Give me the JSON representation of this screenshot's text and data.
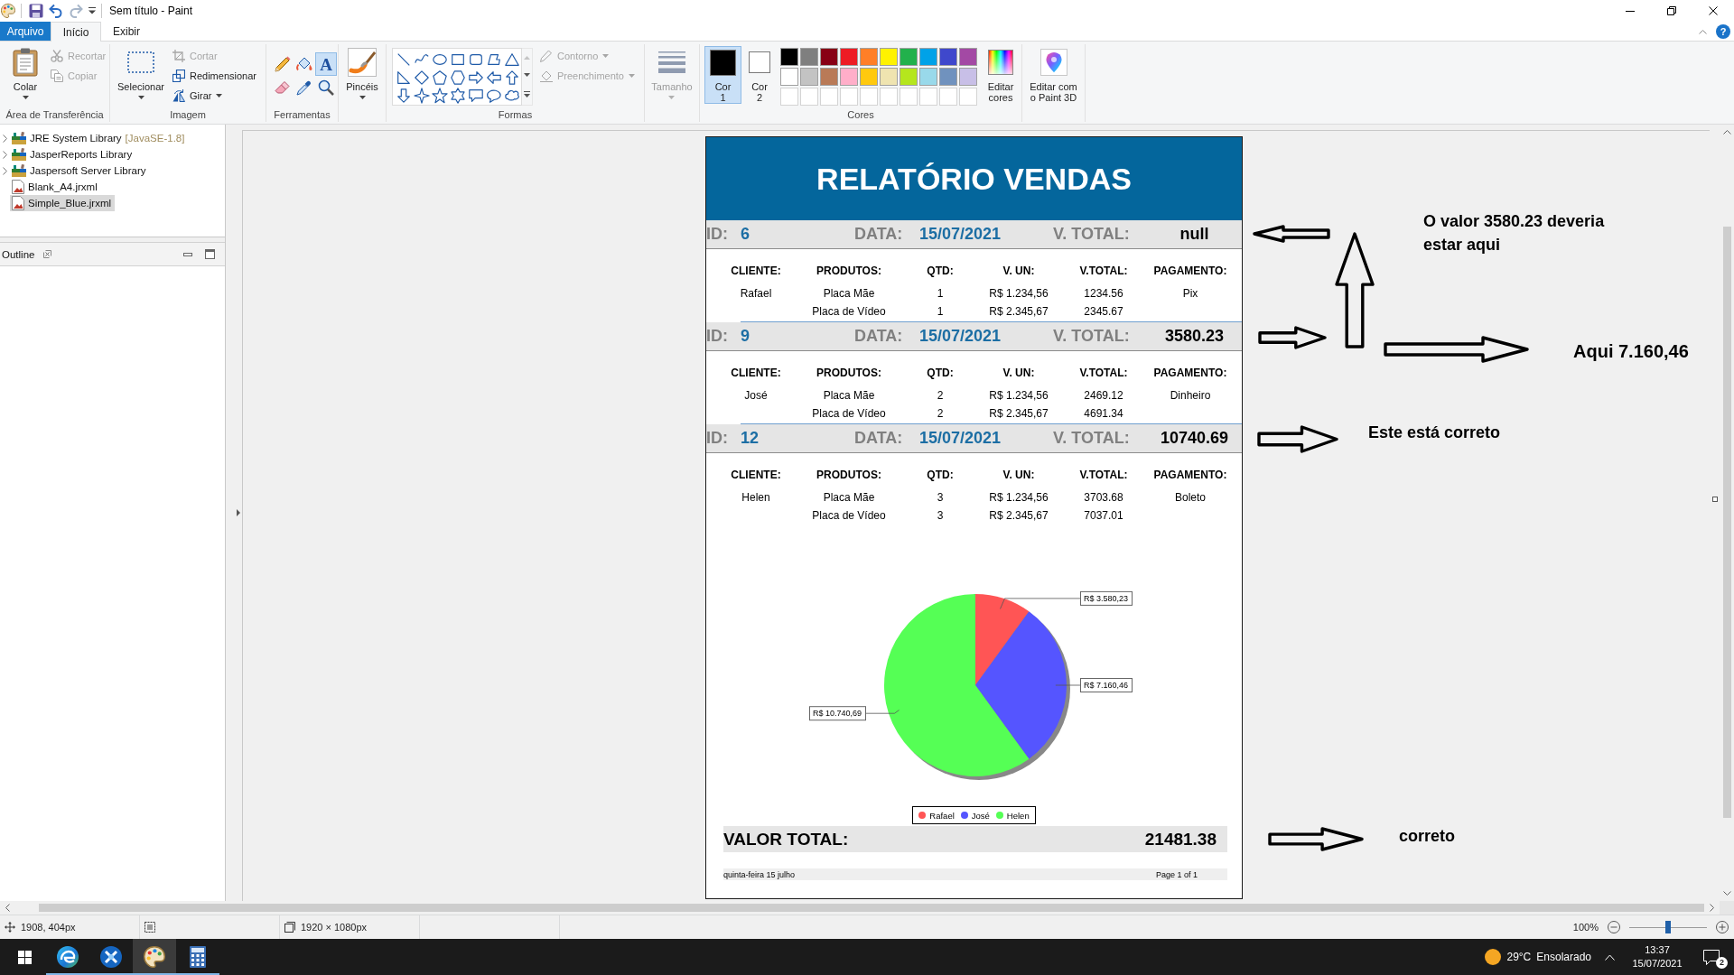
{
  "window": {
    "title": "Sem título - Paint",
    "quick_access": [
      {
        "kind": "save",
        "disabled": false
      },
      {
        "kind": "undo",
        "disabled": false
      },
      {
        "kind": "redo",
        "disabled": true
      }
    ]
  },
  "ribbon": {
    "tabs": [
      {
        "label": "Arquivo",
        "kind": "file",
        "selected": false
      },
      {
        "label": "Início",
        "kind": "tab",
        "selected": true
      },
      {
        "label": "Exibir",
        "kind": "tab",
        "selected": false
      }
    ],
    "help": {
      "glyph": "?"
    },
    "clipboard": {
      "label": "Área de Transferência",
      "paste": {
        "label": "Colar"
      },
      "actions": [
        {
          "kind": "cut",
          "label": "Recortar",
          "disabled": true
        },
        {
          "kind": "copy",
          "label": "Copiar",
          "disabled": true
        }
      ]
    },
    "image": {
      "label": "Imagem",
      "select": {
        "label": "Selecionar"
      },
      "actions": [
        {
          "kind": "crop",
          "label": "Cortar",
          "disabled": true
        },
        {
          "kind": "resize",
          "label": "Redimensionar",
          "disabled": false
        },
        {
          "kind": "rotate",
          "label": "Girar",
          "disabled": false
        }
      ]
    },
    "tools": {
      "label": "Ferramentas",
      "items": [
        {
          "kind": "pencil",
          "selected": false
        },
        {
          "kind": "fill",
          "selected": false
        },
        {
          "kind": "text",
          "glyph": "A",
          "selected": true
        },
        {
          "kind": "eraser",
          "selected": false
        },
        {
          "kind": "picker",
          "selected": false
        },
        {
          "kind": "magnifier",
          "selected": false
        }
      ]
    },
    "brushes": {
      "label": "Pincéis"
    },
    "shapes": {
      "label": "Formas",
      "items": [
        {
          "kind": "line"
        },
        {
          "kind": "curve"
        },
        {
          "kind": "oval"
        },
        {
          "kind": "rectangle"
        },
        {
          "kind": "rounded-rectangle"
        },
        {
          "kind": "polygon"
        },
        {
          "kind": "triangle"
        },
        {
          "kind": "right-triangle"
        },
        {
          "kind": "diamond"
        },
        {
          "kind": "pentagon"
        },
        {
          "kind": "hexagon"
        },
        {
          "kind": "right-arrow"
        },
        {
          "kind": "left-arrow"
        },
        {
          "kind": "up-arrow"
        },
        {
          "kind": "down-arrow"
        },
        {
          "kind": "star4"
        },
        {
          "kind": "star5"
        },
        {
          "kind": "star6"
        },
        {
          "kind": "rect-callout"
        },
        {
          "kind": "oval-callout"
        },
        {
          "kind": "cloud-callout"
        }
      ],
      "outline": {
        "label": "Contorno",
        "disabled": true
      },
      "fill": {
        "label": "Preenchimento",
        "disabled": true
      }
    },
    "size": {
      "label": "Tamanho",
      "disabled": true
    },
    "colors": {
      "label": "Cores",
      "slots": [
        {
          "label": "Cor 1",
          "color": "#000000",
          "selected": true
        },
        {
          "label": "Cor 2",
          "color": "#ffffff",
          "selected": false
        }
      ],
      "palette": [
        {
          "kind": "swatch",
          "color": "#000000"
        },
        {
          "kind": "swatch",
          "color": "#7f7f7f"
        },
        {
          "kind": "swatch",
          "color": "#880015"
        },
        {
          "kind": "swatch",
          "color": "#ed1c24"
        },
        {
          "kind": "swatch",
          "color": "#ff7f27"
        },
        {
          "kind": "swatch",
          "color": "#fff200"
        },
        {
          "kind": "swatch",
          "color": "#22b14c"
        },
        {
          "kind": "swatch",
          "color": "#00a2e8"
        },
        {
          "kind": "swatch",
          "color": "#3f48cc"
        },
        {
          "kind": "swatch",
          "color": "#a349a4"
        },
        {
          "kind": "swatch",
          "color": "#ffffff"
        },
        {
          "kind": "swatch",
          "color": "#c3c3c3"
        },
        {
          "kind": "swatch",
          "color": "#b97a57"
        },
        {
          "kind": "swatch",
          "color": "#ffaec9"
        },
        {
          "kind": "swatch",
          "color": "#ffc90e"
        },
        {
          "kind": "swatch",
          "color": "#efe4b0"
        },
        {
          "kind": "swatch",
          "color": "#b5e61d"
        },
        {
          "kind": "swatch",
          "color": "#99d9ea"
        },
        {
          "kind": "swatch",
          "color": "#7092be"
        },
        {
          "kind": "swatch",
          "color": "#c8bfe7"
        },
        {
          "kind": "empty"
        },
        {
          "kind": "empty"
        },
        {
          "kind": "empty"
        },
        {
          "kind": "empty"
        },
        {
          "kind": "empty"
        },
        {
          "kind": "empty"
        },
        {
          "kind": "empty"
        },
        {
          "kind": "empty"
        },
        {
          "kind": "empty"
        },
        {
          "kind": "empty"
        }
      ],
      "edit": {
        "label": "Editar cores"
      }
    },
    "paint3d": {
      "label": "Editar com o Paint 3D"
    }
  },
  "project_tree": {
    "items": [
      {
        "kind": "library",
        "label": "JRE System Library",
        "decoration": "[JavaSE-1.8]",
        "expanded": false,
        "selected": false
      },
      {
        "kind": "library",
        "label": "JasperReports Library",
        "expanded": false,
        "selected": false
      },
      {
        "kind": "library",
        "label": "Jaspersoft Server Library",
        "expanded": false,
        "selected": false
      },
      {
        "kind": "report",
        "label": "Blank_A4.jrxml",
        "selected": false
      },
      {
        "kind": "report",
        "label": "Simple_Blue.jrxml",
        "selected": true
      }
    ]
  },
  "outline_view": {
    "tab": "Outline"
  },
  "report": {
    "title": "RELATÓRIO VENDAS",
    "orders": [
      {
        "id_label": "ID:",
        "id": "6",
        "date_label": "DATA:",
        "date": "15/07/2021",
        "total_label": "V. TOTAL:",
        "total": "null",
        "columns": [
          "CLIENTE:",
          "PRODUTOS:",
          "QTD:",
          "V. UN:",
          "V.TOTAL:",
          "PAGAMENTO:"
        ],
        "items": [
          {
            "client": "Rafael",
            "product": "Placa Mãe",
            "qty": "1",
            "unit_price": "R$ 1.234,56",
            "total": "1234.56",
            "payment": "Pix"
          },
          {
            "product": "Placa de Vídeo",
            "qty": "1",
            "unit_price": "R$ 2.345,67",
            "total": "2345.67"
          }
        ]
      },
      {
        "id_label": "ID:",
        "id": "9",
        "date_label": "DATA:",
        "date": "15/07/2021",
        "total_label": "V. TOTAL:",
        "total": "3580.23",
        "columns": [
          "CLIENTE:",
          "PRODUTOS:",
          "QTD:",
          "V. UN:",
          "V.TOTAL:",
          "PAGAMENTO:"
        ],
        "items": [
          {
            "client": "José",
            "product": "Placa Mãe",
            "qty": "2",
            "unit_price": "R$ 1.234,56",
            "total": "2469.12",
            "payment": "Dinheiro"
          },
          {
            "product": "Placa de Vídeo",
            "qty": "2",
            "unit_price": "R$ 2.345,67",
            "total": "4691.34"
          }
        ]
      },
      {
        "id_label": "ID:",
        "id": "12",
        "date_label": "DATA:",
        "date": "15/07/2021",
        "total_label": "V. TOTAL:",
        "total": "10740.69",
        "columns": [
          "CLIENTE:",
          "PRODUTOS:",
          "QTD:",
          "V. UN:",
          "V.TOTAL:",
          "PAGAMENTO:"
        ],
        "items": [
          {
            "client": "Helen",
            "product": "Placa Mãe",
            "qty": "3",
            "unit_price": "R$ 1.234,56",
            "total": "3703.68",
            "payment": "Boleto"
          },
          {
            "product": "Placa de Vídeo",
            "qty": "3",
            "unit_price": "R$ 2.345,67",
            "total": "7037.01"
          }
        ]
      }
    ],
    "chart_data": {
      "type": "pie",
      "categories": [
        "Rafael",
        "José",
        "Helen"
      ],
      "values": [
        3580.23,
        10740.69,
        21481.38
      ],
      "value_labels": [
        "R$ 3.580,23",
        "R$ 7.160,46",
        "R$ 10.740,69"
      ],
      "colors": [
        "#ff5555",
        "#5555ff",
        "#55ff55"
      ],
      "legend": "bottom"
    },
    "grand_total": {
      "label": "VALOR TOTAL:",
      "value": "21481.38"
    },
    "footer": {
      "date": "quinta-feira 15 julho",
      "page": "Page 1 of 1"
    }
  },
  "annotations": [
    {
      "text": "O valor 3580.23 deveria estar aqui"
    },
    {
      "text": "Aqui 7.160,46"
    },
    {
      "text": "Este está correto"
    },
    {
      "text": "correto"
    }
  ],
  "status_bar": {
    "position": "1908, 404px",
    "canvas_size": "1920 × 1080px",
    "zoom": "100%",
    "zoom_slider": {
      "level": 0.5
    }
  },
  "taskbar": {
    "apps": [
      {
        "kind": "browser",
        "running": true,
        "selected": false
      },
      {
        "kind": "ide",
        "running": true,
        "selected": false
      },
      {
        "kind": "paint",
        "running": true,
        "selected": true
      },
      {
        "kind": "calculator",
        "running": true,
        "selected": false
      }
    ],
    "weather": {
      "temperature": "29°C",
      "condition": "Ensolarado"
    },
    "time": "13:37",
    "date": "15/07/2021",
    "notifications": "2"
  }
}
